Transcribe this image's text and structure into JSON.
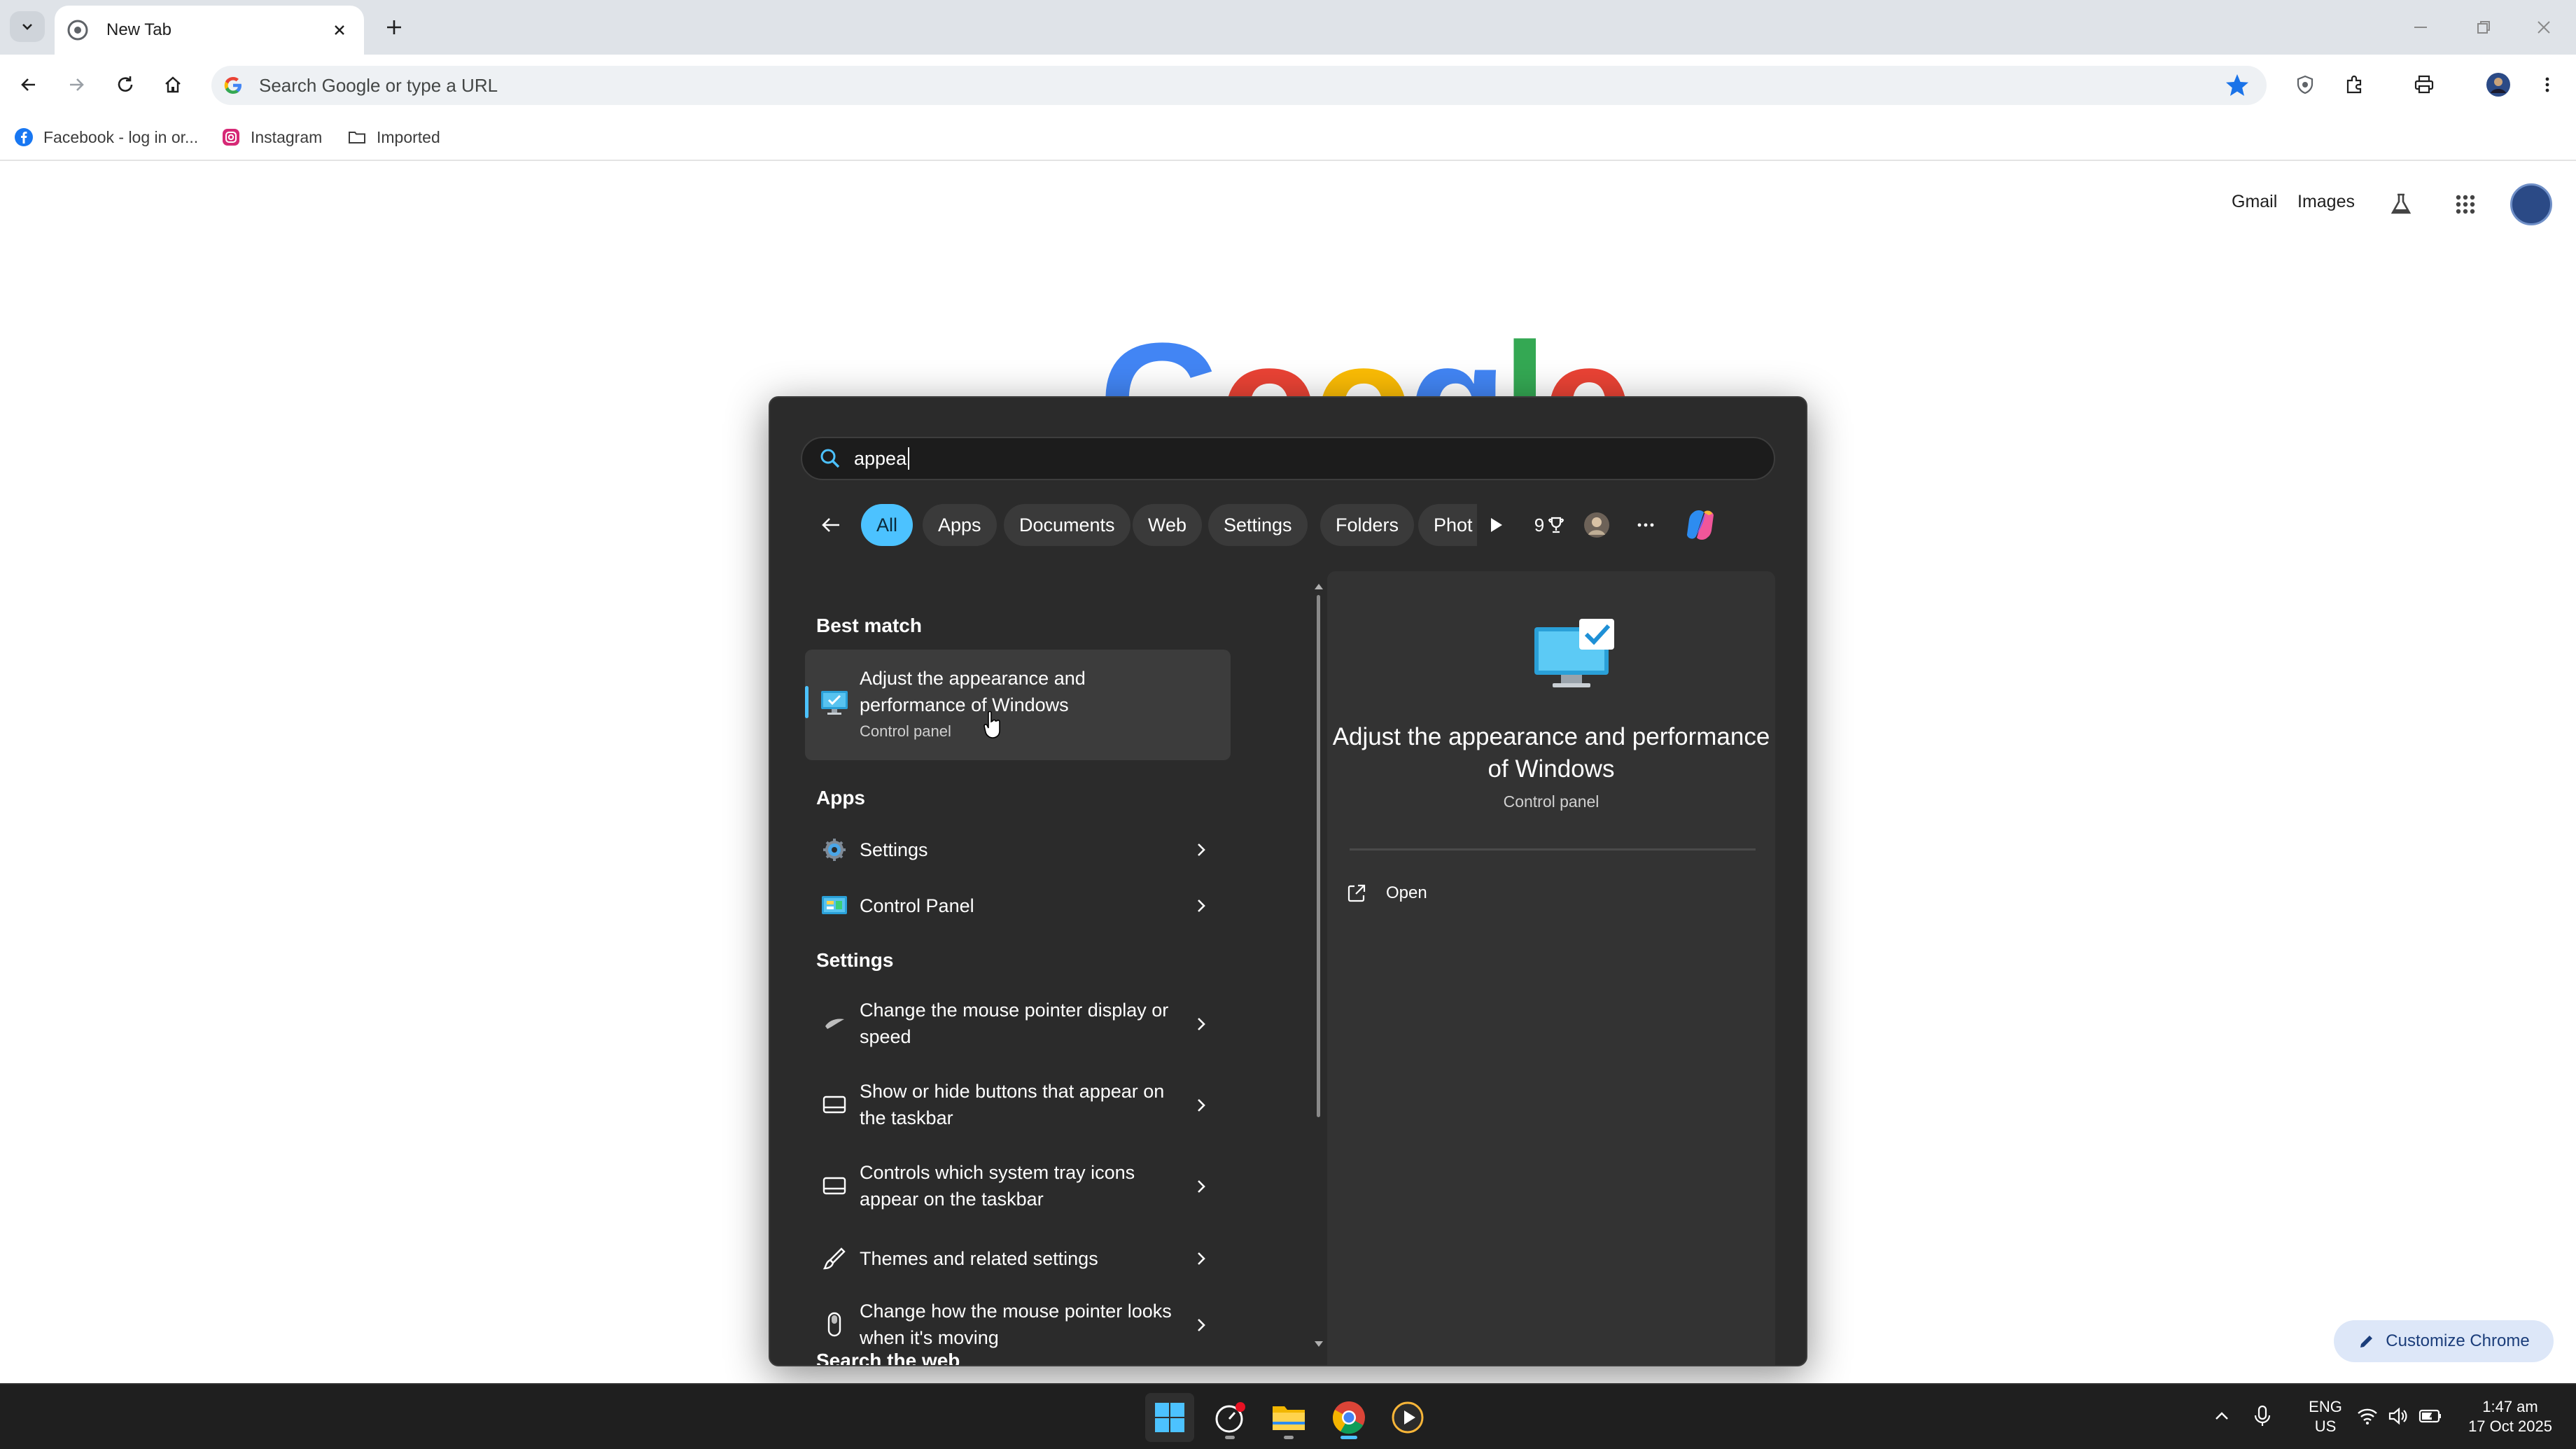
{
  "browser": {
    "tab_title": "New Tab",
    "omnibox_placeholder": "Search Google or type a URL",
    "bookmarks": [
      "Facebook - log in or...",
      "Instagram",
      "Imported"
    ]
  },
  "ntp": {
    "gmail": "Gmail",
    "images": "Images",
    "customize": "Customize Chrome"
  },
  "search_flyout": {
    "query": "appea",
    "filters": [
      "All",
      "Apps",
      "Documents",
      "Web",
      "Settings",
      "Folders",
      "Phot"
    ],
    "active_filter": "All",
    "points": "9",
    "sections": {
      "best_match": "Best match",
      "apps": "Apps",
      "settings": "Settings",
      "search_web": "Search the web"
    },
    "best_match": {
      "title": "Adjust the appearance and performance of Windows",
      "subtitle": "Control panel"
    },
    "apps": [
      {
        "label": "Settings",
        "icon": "settings-gear-icon"
      },
      {
        "label": "Control Panel",
        "icon": "control-panel-icon"
      }
    ],
    "settings": [
      {
        "label": "Change the mouse pointer display or speed",
        "icon": "mouse-pointer-icon"
      },
      {
        "label": "Show or hide buttons that appear on the taskbar",
        "icon": "taskbar-icon"
      },
      {
        "label": "Controls which system tray icons appear on the taskbar",
        "icon": "taskbar-icon"
      },
      {
        "label": "Themes and related settings",
        "icon": "brush-icon"
      },
      {
        "label": "Change how the mouse pointer looks when it's moving",
        "icon": "mouse-icon"
      }
    ],
    "detail": {
      "title": "Adjust the appearance and performance of Windows",
      "subtitle": "Control panel",
      "open": "Open"
    }
  },
  "taskbar": {
    "language": "ENG",
    "region": "US",
    "time": "1:47 am",
    "date": "17 Oct 2025"
  },
  "colors": {
    "accent": "#4cc2ff",
    "flyout_bg": "#2b2b2b",
    "chrome_frame": "#dfe3e8",
    "bookmark_star": "#1a73e8"
  }
}
